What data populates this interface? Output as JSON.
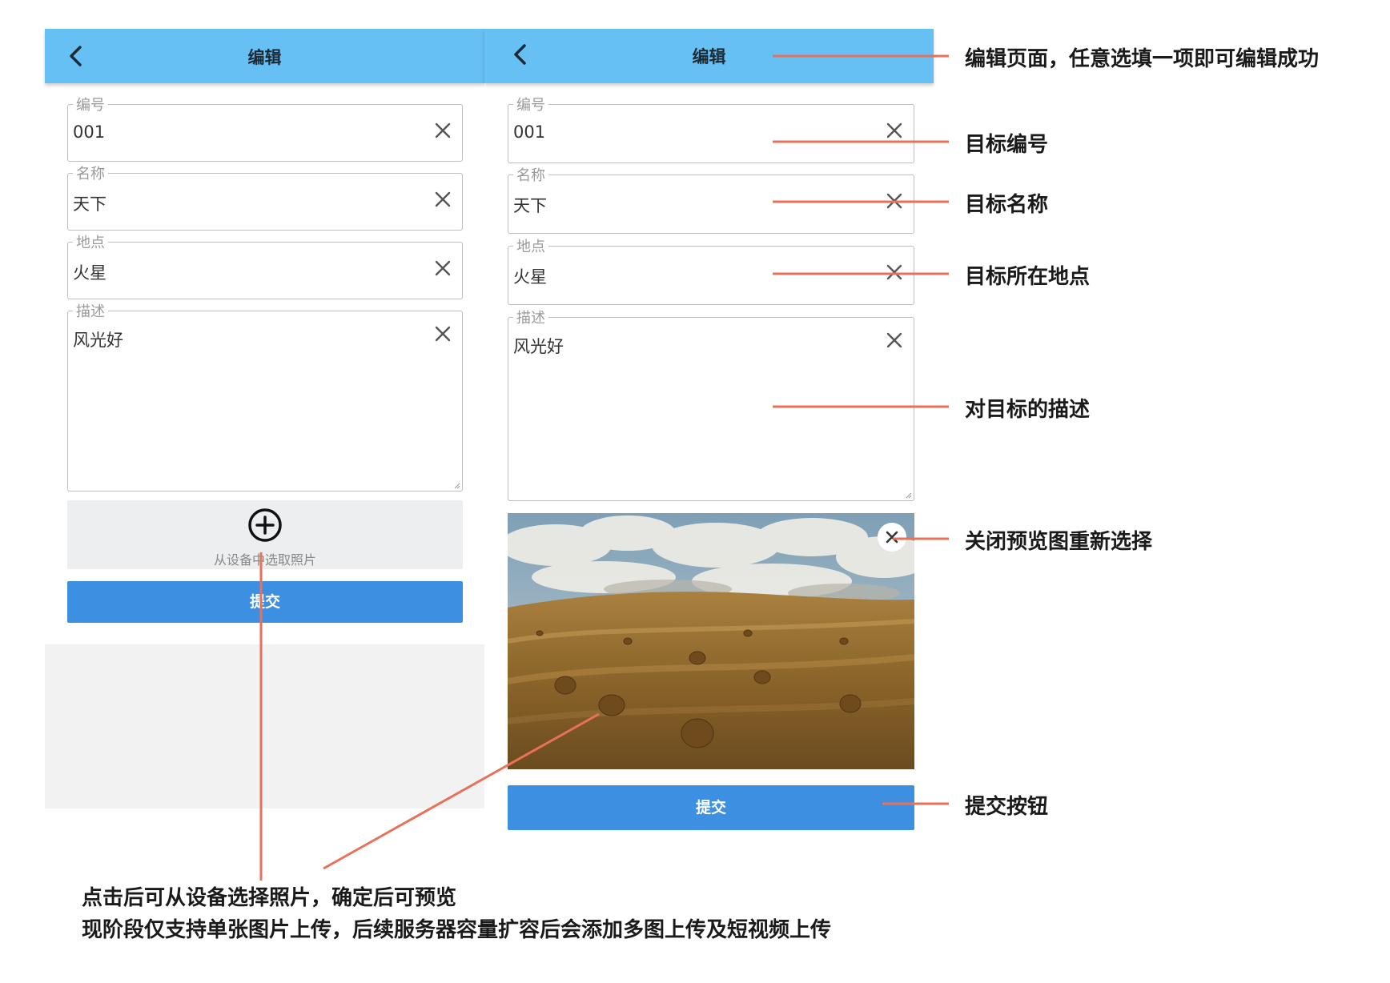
{
  "left_screen": {
    "title": "编辑",
    "fields": [
      {
        "label": "编号",
        "value": "001"
      },
      {
        "label": "名称",
        "value": "天下"
      },
      {
        "label": "地点",
        "value": "火星"
      },
      {
        "label": "描述",
        "value": "风光好"
      }
    ],
    "picker_label": "从设备中选取照片",
    "submit_label": "提交"
  },
  "right_screen": {
    "title": "编辑",
    "fields": [
      {
        "label": "编号",
        "value": "001"
      },
      {
        "label": "名称",
        "value": "天下"
      },
      {
        "label": "地点",
        "value": "火星"
      },
      {
        "label": "描述",
        "value": "风光好"
      }
    ],
    "submit_label": "提交"
  },
  "annotations": {
    "edit_page": "编辑页面，任意选填一项即可编辑成功",
    "target_number": "目标编号",
    "target_name": "目标名称",
    "target_location": "目标所在地点",
    "target_description": "对目标的描述",
    "close_preview": "关闭预览图重新选择",
    "submit_button": "提交按钮",
    "bottom_line_1": "点击后可从设备选择照片，确定后可预览",
    "bottom_line_2": "现阶段仅支持单张图片上传，后续服务器容量扩容后会添加多图上传及短视频上传"
  },
  "colors": {
    "appbar": "#66c0f4",
    "submit": "#3d8fe2",
    "callout_line": "#e8715a"
  },
  "icons": {
    "back": "chevron-left-icon",
    "clear": "close-icon",
    "add_photo": "plus-circle-icon",
    "close_preview": "close-icon"
  }
}
